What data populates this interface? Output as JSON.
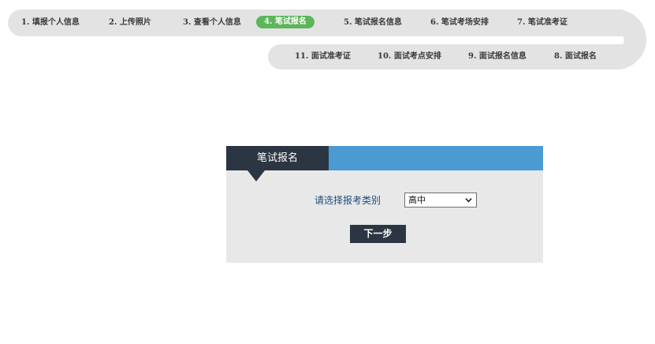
{
  "progress_steps": {
    "row1": [
      {
        "label": "1. 填报个人信息",
        "active": false
      },
      {
        "label": "2. 上传照片",
        "active": false
      },
      {
        "label": "3. 查看个人信息",
        "active": false
      },
      {
        "label": "4. 笔试报名",
        "active": true
      },
      {
        "label": "5. 笔试报名信息",
        "active": false
      },
      {
        "label": "6. 笔试考场安排",
        "active": false
      },
      {
        "label": "7. 笔试准考证",
        "active": false
      }
    ],
    "row2": [
      {
        "label": "11. 面试准考证",
        "active": false
      },
      {
        "label": "10. 面试考点安排",
        "active": false
      },
      {
        "label": "9. 面试报名信息",
        "active": false
      },
      {
        "label": "8. 面试报名",
        "active": false
      }
    ],
    "active_color": "#5cb65a",
    "track_color": "#e3e3e3"
  },
  "panel": {
    "title": "笔试报名",
    "exam_type_label": "请选择报考类别",
    "exam_type_selected": "高中",
    "next_button_label": "下一步",
    "header_color": "#4b9ad4",
    "tab_color": "#2b3642",
    "body_color": "#e8e8e8",
    "icons": {
      "dropdown": "chevron-down-icon"
    }
  }
}
